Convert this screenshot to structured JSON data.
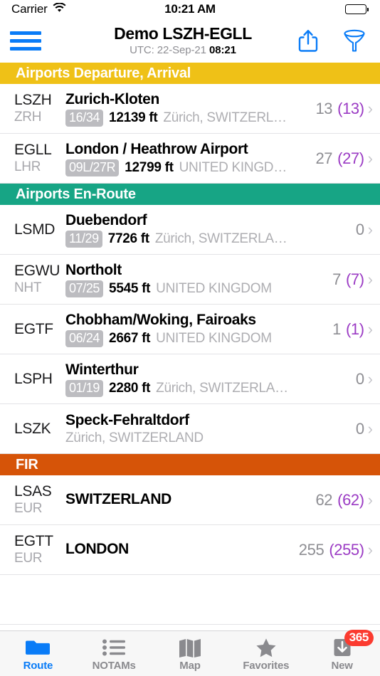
{
  "status_bar": {
    "carrier": "Carrier",
    "wifi_icon": "wifi-icon",
    "time": "10:21 AM",
    "battery_icon": "battery-full-icon"
  },
  "navbar": {
    "menu_icon": "hamburger-menu-icon",
    "title": "Demo LSZH-EGLL",
    "subtitle_prefix": "UTC: 22-Sep-21 ",
    "subtitle_time": "08:21",
    "share_icon": "share-icon",
    "filter_icon": "filter-funnel-icon"
  },
  "colors": {
    "departure_arrival_header": "#EFC117",
    "enroute_header": "#17A585",
    "fir_header": "#D65408",
    "accent_blue": "#0A7CF7",
    "count_purple": "#9B3BC4",
    "badge_red": "#FB3B30",
    "runway_badge_gray": "#BCBCC0"
  },
  "sections": [
    {
      "title": "Airports Departure, Arrival",
      "color": "#EFC117",
      "rows": [
        {
          "icao": "LSZH",
          "iata": "ZRH",
          "name": "Zurich-Kloten",
          "runway": "16/34",
          "elevation": "12139 ft",
          "location": "Zürich, SWITZERL…",
          "count": "13",
          "count_paren": "(13)"
        },
        {
          "icao": "EGLL",
          "iata": "LHR",
          "name": "London / Heathrow Airport",
          "runway": "09L/27R",
          "elevation": "12799 ft",
          "location": "UNITED KINGD…",
          "count": "27",
          "count_paren": "(27)"
        }
      ]
    },
    {
      "title": "Airports En-Route",
      "color": "#17A585",
      "rows": [
        {
          "icao": "LSMD",
          "iata": "",
          "name": "Duebendorf",
          "runway": "11/29",
          "elevation": "7726 ft",
          "location": "Zürich, SWITZERLA…",
          "count": "0",
          "count_paren": ""
        },
        {
          "icao": "EGWU",
          "iata": "NHT",
          "name": "Northolt",
          "runway": "07/25",
          "elevation": "5545 ft",
          "location": "UNITED KINGDOM",
          "count": "7",
          "count_paren": "(7)"
        },
        {
          "icao": "EGTF",
          "iata": "",
          "name": "Chobham/Woking, Fairoaks",
          "runway": "06/24",
          "elevation": "2667 ft",
          "location": "UNITED KINGDOM",
          "count": "1",
          "count_paren": "(1)"
        },
        {
          "icao": "LSPH",
          "iata": "",
          "name": "Winterthur",
          "runway": "01/19",
          "elevation": "2280 ft",
          "location": "Zürich, SWITZERLA…",
          "count": "0",
          "count_paren": ""
        },
        {
          "icao": "LSZK",
          "iata": "",
          "name": "Speck-Fehraltdorf",
          "runway": "",
          "elevation": "",
          "location": "Zürich, SWITZERLAND",
          "count": "0",
          "count_paren": ""
        }
      ]
    },
    {
      "title": "FIR",
      "color": "#D65408",
      "rows": [
        {
          "icao": "LSAS",
          "iata": "EUR",
          "name": "SWITZERLAND",
          "runway": "",
          "elevation": "",
          "location": "",
          "count": "62",
          "count_paren": "(62)"
        },
        {
          "icao": "EGTT",
          "iata": "EUR",
          "name": "LONDON",
          "runway": "",
          "elevation": "",
          "location": "",
          "count": "255",
          "count_paren": "(255)"
        }
      ]
    }
  ],
  "tabbar": {
    "items": [
      {
        "label": "Route",
        "icon": "folder-icon",
        "active": true,
        "badge": ""
      },
      {
        "label": "NOTAMs",
        "icon": "bullet-list-icon",
        "active": false,
        "badge": ""
      },
      {
        "label": "Map",
        "icon": "map-icon",
        "active": false,
        "badge": ""
      },
      {
        "label": "Favorites",
        "icon": "star-icon",
        "active": false,
        "badge": ""
      },
      {
        "label": "New",
        "icon": "download-icon",
        "active": false,
        "badge": "365"
      }
    ]
  }
}
